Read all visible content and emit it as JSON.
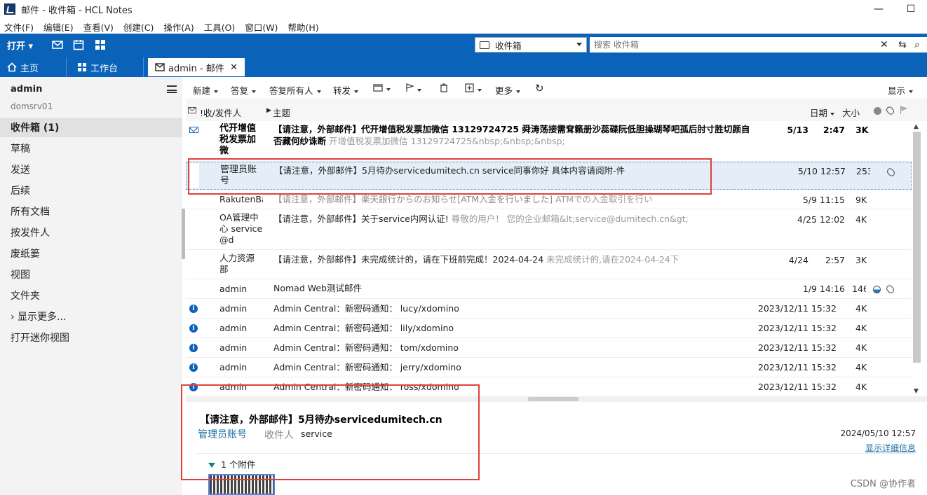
{
  "window": {
    "title": "邮件 - 收件箱 - HCL Notes",
    "minimize": "—",
    "maximize": "☐"
  },
  "menubar": [
    "文件(F)",
    "编辑(E)",
    "查看(V)",
    "创建(C)",
    "操作(A)",
    "工具(O)",
    "窗口(W)",
    "帮助(H)"
  ],
  "toolbar": {
    "open_label": "打开 ▾",
    "folder": "收件箱",
    "search_placeholder": "搜索 收件箱",
    "clear": "✕",
    "settings": "⇆",
    "search": "⌕"
  },
  "tabs": [
    {
      "label": "主页"
    },
    {
      "label": "工作台"
    },
    {
      "label": "admin - 邮件",
      "close": "✕"
    }
  ],
  "sidebar": {
    "user": "admin",
    "server": "domsrv01",
    "items": [
      {
        "label": "收件箱 (1)"
      },
      {
        "label": "草稿"
      },
      {
        "label": "发送"
      },
      {
        "label": "后续"
      },
      {
        "label": "所有文档"
      },
      {
        "label": "按发件人"
      },
      {
        "label": "废纸篓"
      },
      {
        "label": "视图"
      },
      {
        "label": "文件夹"
      },
      {
        "label": "› 显示更多..."
      },
      {
        "label": "打开迷你视图"
      }
    ]
  },
  "actions": [
    "新建",
    "答复",
    "答复所有人",
    "转发",
    "更多"
  ],
  "columns": {
    "sender": "!收/发件人",
    "subject": "主题",
    "date": "日期",
    "size": "大小"
  },
  "messages": [
    {
      "sender": "代开增值税发票加微",
      "subject": "【请注意，外部邮件】代开增值税发票加微信 13129724725 舜涛荡接需耷籁册沙蕊碟阮低胆操瑚琴吧孤后肘寸胜切颜自否藏何纱诛断",
      "preview": "开增值税发票加微信 13129724725&nbsp;&nbsp;&nbsp;",
      "date": "5/13",
      "time": "2:47",
      "size": "3K"
    },
    {
      "sender": "管理员账号",
      "subject": "【请注意，外部邮件】5月待办servicedumitech.cn  service同事你好 具体内容请阅附-件",
      "preview": "",
      "date": "5/10 12:57",
      "size": "253K"
    },
    {
      "sender": "RakutenBa",
      "subject": "【请注意，外部邮件】楽天銀行からのお知らせ[ATM入金を行いました]",
      "preview": "ATMでの入金取引を行い",
      "date": "5/9 11:15",
      "size": "9K"
    },
    {
      "sender": "OA管理中心 service@d",
      "subject": "【请注意，外部邮件】关于service内网认证!",
      "preview": "尊敬的用户！ 您的企业邮箱&lt;service@dumitech.cn&gt;",
      "date": "4/25 12:02",
      "size": "4K"
    },
    {
      "sender": "人力资源部",
      "subject": "【请注意，外部邮件】未完成统计的，请在下班前完成！2024-04-24",
      "preview": "未完成统计的,请在2024-04-24下",
      "date": "4/24",
      "time": "2:57",
      "size": "3K"
    },
    {
      "sender": "admin",
      "subject": "Nomad Web测试邮件",
      "preview": "",
      "date": "1/9 14:16",
      "size": "146K"
    },
    {
      "sender": "admin",
      "subject": "Admin Central：新密码通知： lucy/xdomino",
      "preview": "",
      "date": "2023/12/11 15:32",
      "size": "4K"
    },
    {
      "sender": "admin",
      "subject": "Admin Central：新密码通知： lily/xdomino",
      "preview": "",
      "date": "2023/12/11 15:32",
      "size": "4K"
    },
    {
      "sender": "admin",
      "subject": "Admin Central：新密码通知： tom/xdomino",
      "preview": "",
      "date": "2023/12/11 15:32",
      "size": "4K"
    },
    {
      "sender": "admin",
      "subject": "Admin Central：新密码通知： jerry/xdomino",
      "preview": "",
      "date": "2023/12/11 15:32",
      "size": "4K"
    },
    {
      "sender": "admin",
      "subject": "Admin Central：新密码通知： ross/xdomino",
      "preview": "",
      "date": "2023/12/11 15:32",
      "size": "4K"
    }
  ],
  "preview": {
    "subject": "【请注意，外部邮件】5月待办servicedumitech.cn",
    "from": "管理员账号",
    "to_label": "收件人",
    "to": "service",
    "date": "2024/05/10 12:57",
    "details_link": "显示详细信息",
    "attachments": "1  个附件"
  },
  "watermark": "CSDN @协作者",
  "colors": {
    "accent": "#0a63b8",
    "highlight_box": "#e0403c",
    "selected_row": "#e3eef9"
  }
}
